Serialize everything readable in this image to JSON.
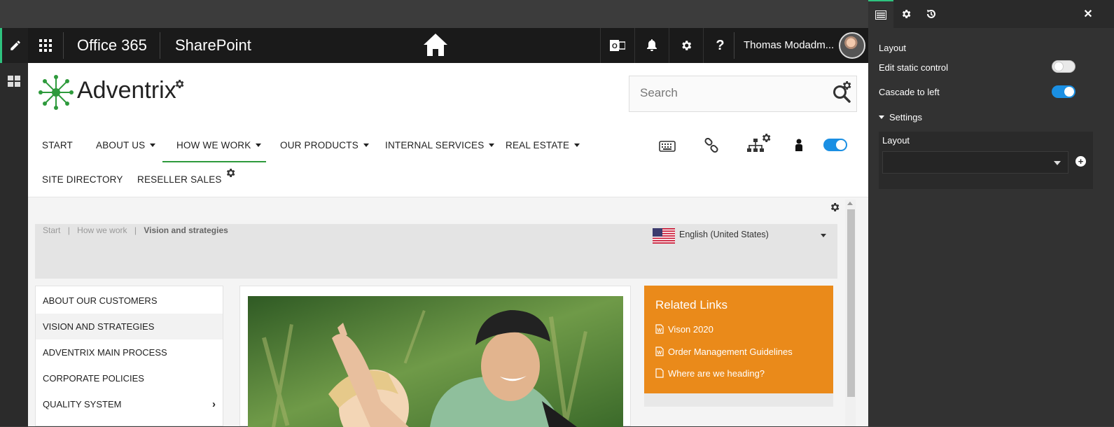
{
  "suite": {
    "app_name": "Office 365",
    "product": "SharePoint",
    "user_name": "Thomas Modadm..."
  },
  "site": {
    "brand": "Adventrix",
    "search_placeholder": "Search"
  },
  "nav": {
    "items": [
      {
        "label": "START"
      },
      {
        "label": "ABOUT US"
      },
      {
        "label": "HOW WE WORK"
      },
      {
        "label": "OUR PRODUCTS"
      },
      {
        "label": "INTERNAL SERVICES"
      },
      {
        "label": "REAL ESTATE"
      },
      {
        "label": "SITE DIRECTORY"
      },
      {
        "label": "RESELLER SALES"
      }
    ],
    "active": "HOW WE WORK"
  },
  "breadcrumb": {
    "items": [
      "Start",
      "How we work",
      "Vision and strategies"
    ],
    "separator": "|"
  },
  "language": {
    "selected": "English (United States)"
  },
  "left_nav": {
    "items": [
      {
        "label": "ABOUT OUR CUSTOMERS"
      },
      {
        "label": "VISION AND STRATEGIES"
      },
      {
        "label": "ADVENTRIX MAIN PROCESS"
      },
      {
        "label": "CORPORATE POLICIES"
      },
      {
        "label": "QUALITY SYSTEM"
      }
    ],
    "selected": "VISION AND STRATEGIES"
  },
  "related_links": {
    "title": "Related Links",
    "links": [
      {
        "label": "Vison 2020",
        "icon": "word-doc-icon"
      },
      {
        "label": "Order Management Guidelines",
        "icon": "word-doc-icon"
      },
      {
        "label": "Where are we heading?",
        "icon": "page-icon"
      }
    ]
  },
  "panel": {
    "section_title": "Layout",
    "edit_static_control": {
      "label": "Edit static control",
      "on": false
    },
    "cascade_to_left": {
      "label": "Cascade to left",
      "on": true
    },
    "settings_label": "Settings",
    "layout_field_label": "Layout",
    "layout_value": ""
  },
  "colors": {
    "accent_green": "#2ec27e",
    "toggle_blue": "#1a8fe3",
    "related_orange": "#ea8a1a",
    "nav_active": "#2e9a3c"
  }
}
